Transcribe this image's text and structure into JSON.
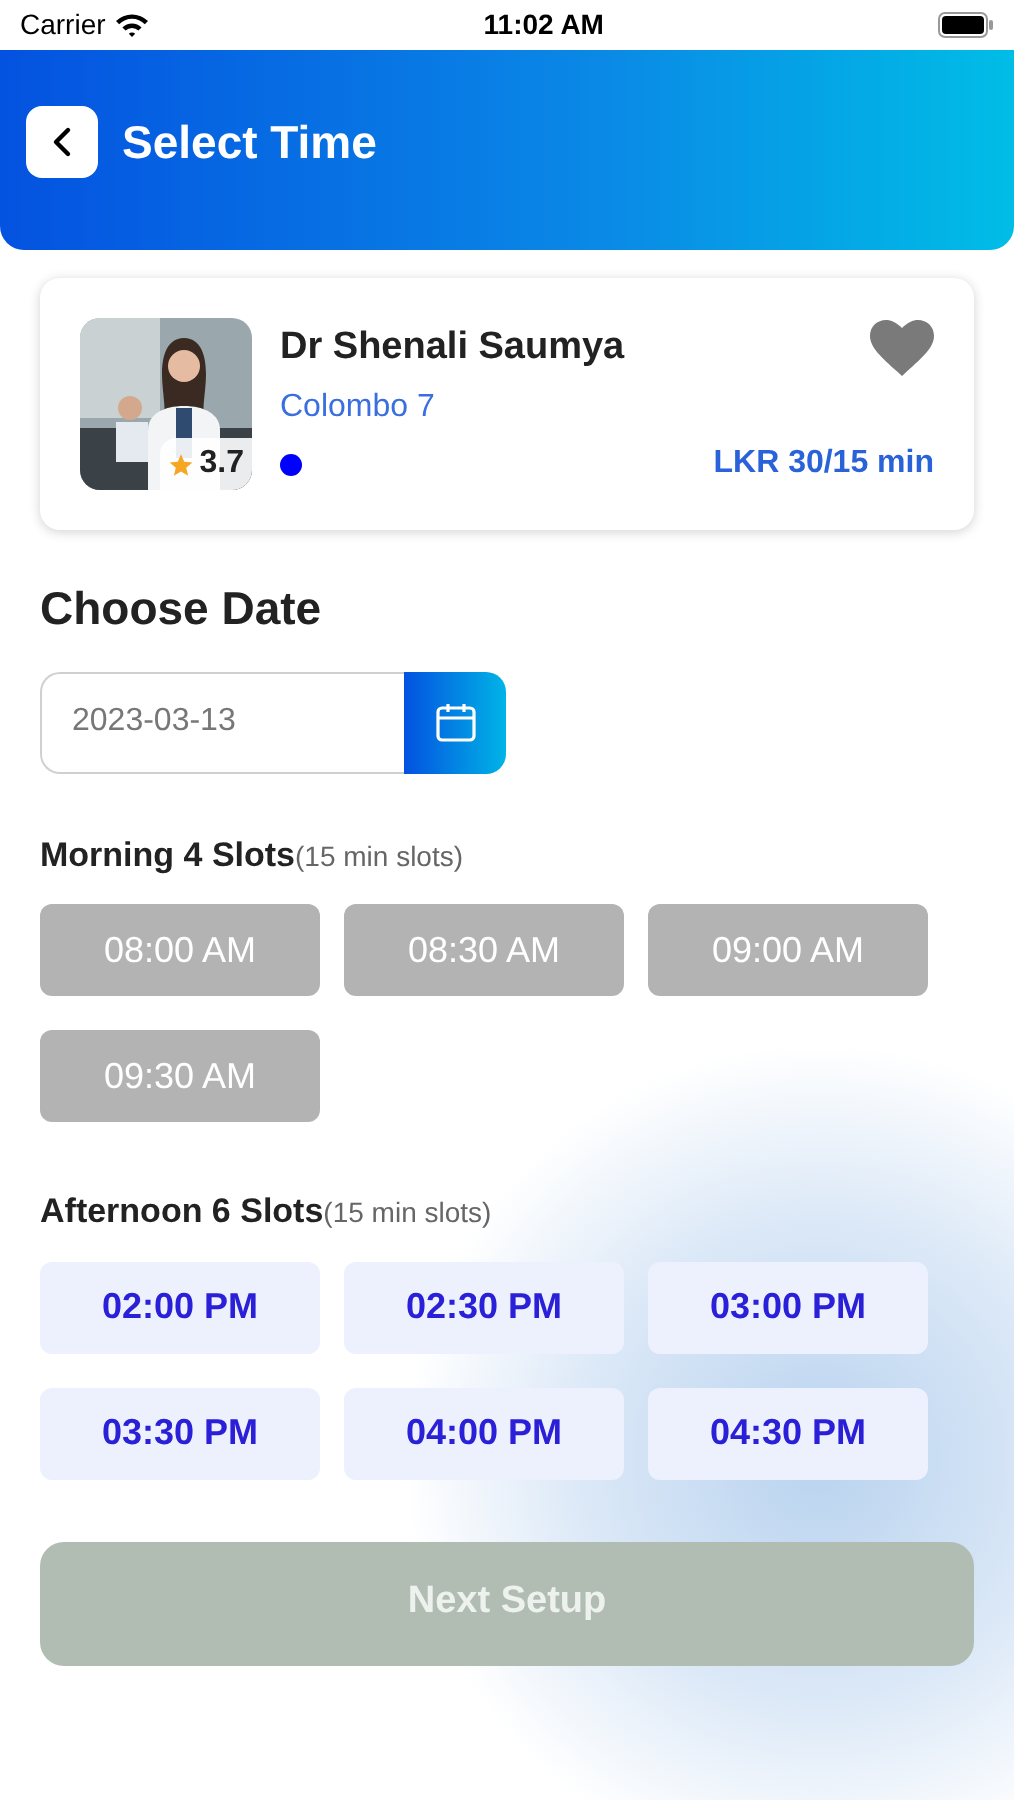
{
  "status_bar": {
    "carrier": "Carrier",
    "time": "11:02 AM"
  },
  "header": {
    "title": "Select Time"
  },
  "doctor": {
    "name": "Dr Shenali Saumya",
    "location": "Colombo 7",
    "rating": "3.7",
    "online": true,
    "fee": "LKR 30/15 min",
    "favorite": false
  },
  "date": {
    "heading": "Choose Date",
    "value": "2023-03-13"
  },
  "sessions": [
    {
      "title": "Morning 4 Slots",
      "note": "(15 min slots)",
      "slots": [
        {
          "time": "08:00 AM",
          "disabled": true
        },
        {
          "time": "08:30 AM",
          "disabled": true
        },
        {
          "time": "09:00 AM",
          "disabled": true
        },
        {
          "time": "09:30 AM",
          "disabled": true
        }
      ]
    },
    {
      "title": "Afternoon 6 Slots",
      "note": "(15 min slots)",
      "slots": [
        {
          "time": "02:00 PM",
          "disabled": false
        },
        {
          "time": "02:30 PM",
          "disabled": false
        },
        {
          "time": "03:00 PM",
          "disabled": false
        },
        {
          "time": "03:30 PM",
          "disabled": false
        },
        {
          "time": "04:00 PM",
          "disabled": false
        },
        {
          "time": "04:30 PM",
          "disabled": false
        }
      ]
    }
  ],
  "next_button": {
    "label": "Next Setup",
    "disabled": true
  }
}
